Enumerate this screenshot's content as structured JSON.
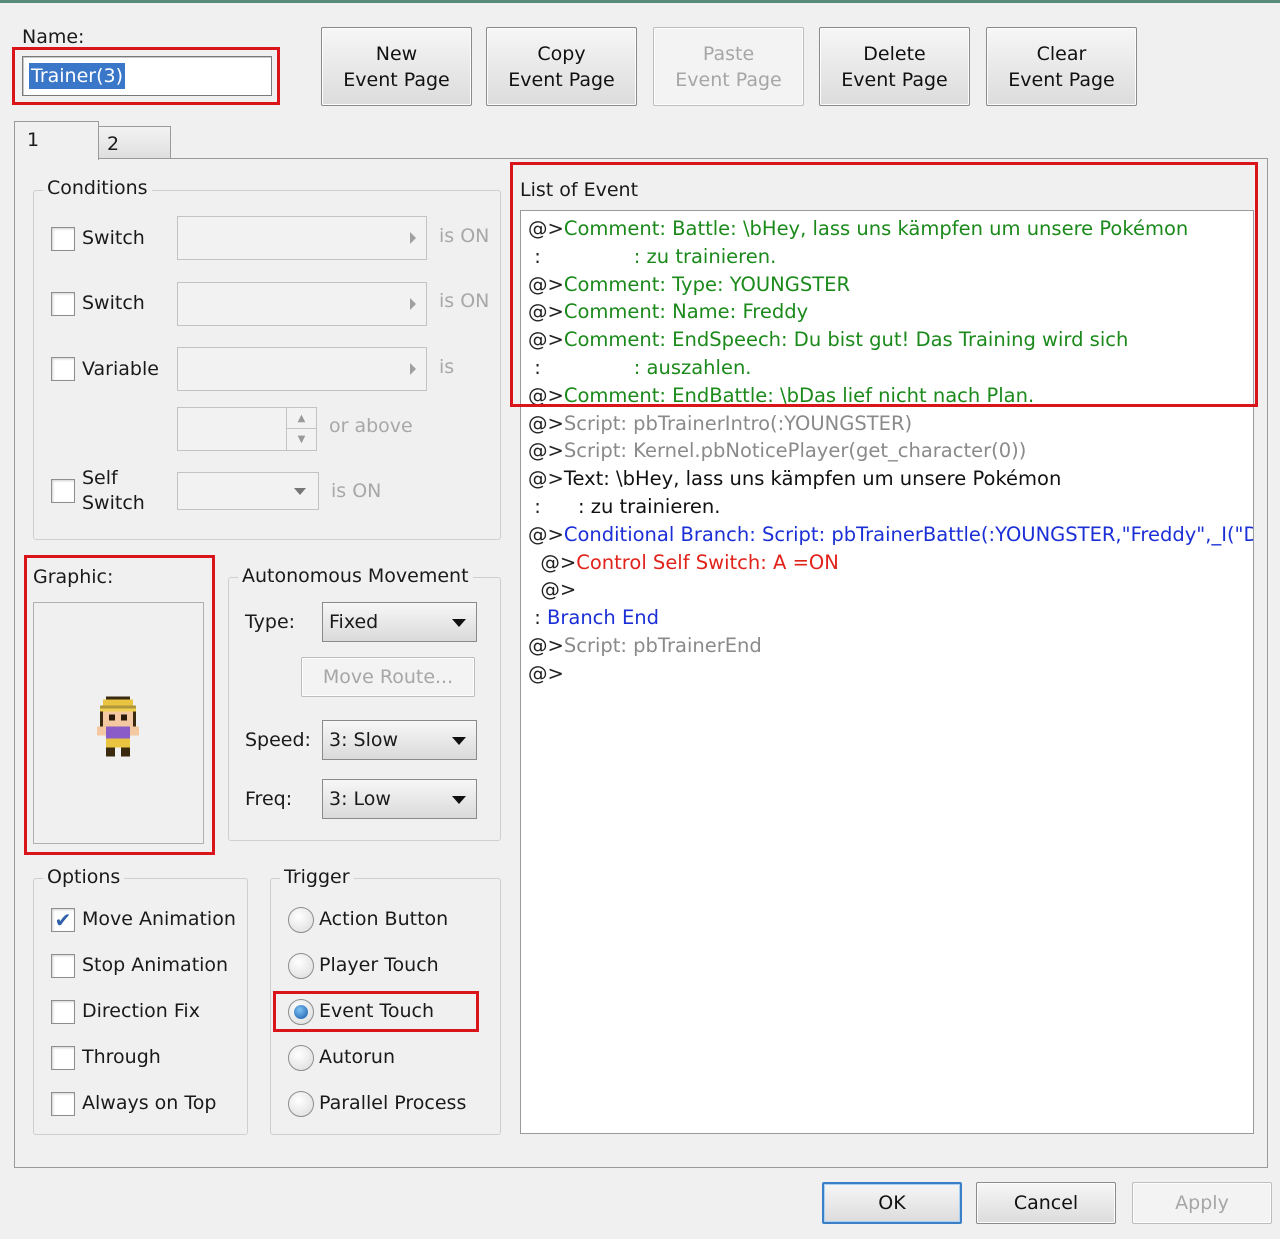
{
  "name_label": "Name:",
  "name_value": "Trainer(3)",
  "toolbar": {
    "new": [
      "New",
      "Event Page"
    ],
    "copy": [
      "Copy",
      "Event Page"
    ],
    "paste": [
      "Paste",
      "Event Page"
    ],
    "delete": [
      "Delete",
      "Event Page"
    ],
    "clear": [
      "Clear",
      "Event Page"
    ]
  },
  "tabs": [
    "1",
    "2"
  ],
  "conditions": {
    "title": "Conditions",
    "switch1": "Switch",
    "switch2": "Switch",
    "variable": "Variable",
    "self_switch_line1": "Self",
    "self_switch_line2": "Switch",
    "is_on": "is ON",
    "is": "is",
    "or_above": "or above"
  },
  "graphic_label": "Graphic:",
  "autonomous": {
    "title": "Autonomous Movement",
    "type_label": "Type:",
    "type_value": "Fixed",
    "move_route": "Move Route...",
    "speed_label": "Speed:",
    "speed_value": "3: Slow",
    "freq_label": "Freq:",
    "freq_value": "3: Low"
  },
  "options": {
    "title": "Options",
    "items": [
      "Move Animation",
      "Stop Animation",
      "Direction Fix",
      "Through",
      "Always on Top"
    ],
    "checked": [
      true,
      false,
      false,
      false,
      false
    ]
  },
  "trigger": {
    "title": "Trigger",
    "items": [
      "Action Button",
      "Player Touch",
      "Event Touch",
      "Autorun",
      "Parallel Process"
    ],
    "selected": "Event Touch"
  },
  "event_list": {
    "title": "List of Event",
    "lines": [
      {
        "prefix": "@>",
        "text": "Comment: Battle: \\bHey, lass uns kämpfen um unsere Pokémon",
        "color": "green"
      },
      {
        "prefix": " :",
        "text": "               : zu trainieren.",
        "color": "green"
      },
      {
        "prefix": "@>",
        "text": "Comment: Type: YOUNGSTER",
        "color": "green"
      },
      {
        "prefix": "@>",
        "text": "Comment: Name: Freddy",
        "color": "green"
      },
      {
        "prefix": "@>",
        "text": "Comment: EndSpeech: Du bist gut! Das Training wird sich",
        "color": "green"
      },
      {
        "prefix": " :",
        "text": "               : auszahlen.",
        "color": "green"
      },
      {
        "prefix": "@>",
        "text": "Comment: EndBattle: \\bDas lief nicht nach Plan.",
        "color": "green"
      },
      {
        "prefix": "@>",
        "text": "Script: pbTrainerIntro(:YOUNGSTER)",
        "color": "gray"
      },
      {
        "prefix": "@>",
        "text": "Script: Kernel.pbNoticePlayer(get_character(0))",
        "color": "gray"
      },
      {
        "prefix": "@>",
        "text": "Text: \\bHey, lass uns kämpfen um unsere Pokémon",
        "color": "black"
      },
      {
        "prefix": " :",
        "text": "      : zu trainieren.",
        "color": "black"
      },
      {
        "prefix": "@>",
        "text": "Conditional Branch: Script: pbTrainerBattle(:YOUNGSTER,\"Freddy\",_I(\"Du",
        "color": "blue"
      },
      {
        "prefix": "  @>",
        "text": "Control Self Switch: A =ON",
        "color": "red"
      },
      {
        "prefix": "  @>",
        "text": "",
        "color": "black"
      },
      {
        "prefix": " : ",
        "text": "Branch End",
        "color": "blue"
      },
      {
        "prefix": "@>",
        "text": "Script: pbTrainerEnd",
        "color": "gray"
      },
      {
        "prefix": "@>",
        "text": "",
        "color": "black"
      }
    ]
  },
  "footer": {
    "ok": "OK",
    "cancel": "Cancel",
    "apply": "Apply"
  },
  "colors": {
    "highlight_red": "#d9141b",
    "comment_green": "#1b8a1b",
    "branch_blue": "#1b2fd6",
    "switch_red": "#e0221b",
    "script_gray": "#8a8a8a",
    "selection_blue": "#3a77c9"
  }
}
